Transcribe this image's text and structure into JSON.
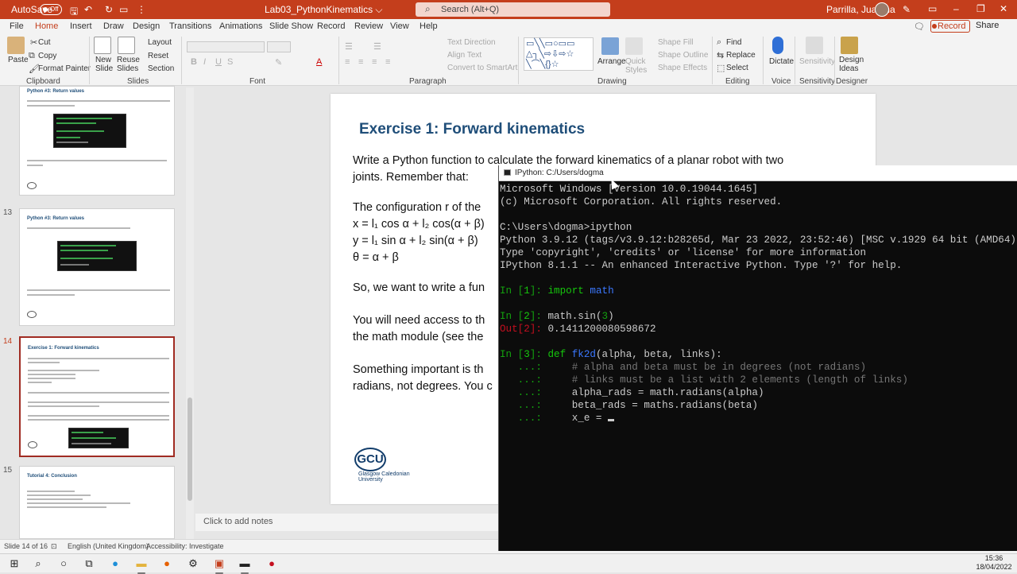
{
  "titlebar": {
    "autosave_label": "AutoSave",
    "autosave_state": "Off",
    "doc_title": "Lab03_PythonKinematics ⌵",
    "search_placeholder": "Search (Alt+Q)",
    "user_name": "Parrilla, Juanma",
    "minimize": "–",
    "restore": "❐",
    "close": "✕"
  },
  "tabs": [
    "File",
    "Home",
    "Insert",
    "Draw",
    "Design",
    "Transitions",
    "Animations",
    "Slide Show",
    "Record",
    "Review",
    "View",
    "Help"
  ],
  "active_tab": "Home",
  "record_button": "Record",
  "share_button": "Share",
  "ribbon": {
    "clipboard": {
      "paste": "Paste",
      "cut": "Cut",
      "copy": "Copy",
      "format_painter": "Format Painter",
      "group": "Clipboard"
    },
    "slides": {
      "new_slide": "New Slide",
      "reuse_slides": "Reuse Slides",
      "layout": "Layout",
      "reset": "Reset",
      "section": "Section",
      "group": "Slides"
    },
    "font": {
      "group": "Font"
    },
    "paragraph": {
      "text_direction": "Text Direction",
      "align_text": "Align Text",
      "smartart": "Convert to SmartArt",
      "group": "Paragraph"
    },
    "drawing": {
      "arrange": "Arrange",
      "quick_styles": "Quick Styles",
      "shape_fill": "Shape Fill",
      "shape_outline": "Shape Outline",
      "shape_effects": "Shape Effects",
      "group": "Drawing"
    },
    "editing": {
      "find": "Find",
      "replace": "Replace",
      "select": "Select",
      "group": "Editing"
    },
    "voice": {
      "dictate": "Dictate",
      "group": "Voice"
    },
    "sensitivity": {
      "label": "Sensitivity",
      "group": "Sensitivity"
    },
    "designer": {
      "design_ideas": "Design Ideas",
      "group": "Designer"
    }
  },
  "thumbnails": [
    {
      "title": "Python #3: Return values",
      "num": ""
    },
    {
      "title": "Python #3: Return values",
      "num": "13"
    },
    {
      "title": "Exercise 1: Forward kinematics",
      "num": "14"
    },
    {
      "title": "Tutorial 4: Conclusion",
      "num": "15"
    }
  ],
  "slide": {
    "title": "Exercise 1: Forward kinematics",
    "lines": [
      "Write a Python function to calculate the forward kinematics of a planar robot with two",
      "joints. Remember that:",
      "The configuration r of the",
      "x = l₁ cos α + l₂ cos(α + β)",
      "y = l₁ sin α + l₂ sin(α + β)",
      "θ = α + β",
      "So, we want to write a fun",
      "You will need access to th",
      "the math module (see the",
      "Something important is th",
      "radians, not degrees. You c"
    ],
    "logo_mark": "GCU",
    "logo_name_1": "Glasgow Caledonian",
    "logo_name_2": "University"
  },
  "notes_placeholder": "Click to add notes",
  "status": {
    "slide_count": "Slide 14 of 16",
    "language": "English (United Kingdom)",
    "accessibility": "Accessibility: Investigate"
  },
  "console": {
    "title": "IPython: C:/Users/dogma",
    "lines": [
      [
        {
          "t": "Microsoft Windows [Version 10.0.19044.1645]",
          "c": ""
        }
      ],
      [
        {
          "t": "(c) Microsoft Corporation. All rights reserved.",
          "c": ""
        }
      ],
      [
        {
          "t": "",
          "c": ""
        }
      ],
      [
        {
          "t": "C:\\Users\\dogma>ipython",
          "c": ""
        }
      ],
      [
        {
          "t": "Python 3.9.12 (tags/v3.9.12:b28265d, Mar 23 2022, 23:52:46) [MSC v.1929 64 bit (AMD64)]",
          "c": ""
        }
      ],
      [
        {
          "t": "Type 'copyright', 'credits' or 'license' for more information",
          "c": ""
        }
      ],
      [
        {
          "t": "IPython 8.1.1 -- An enhanced Interactive Python. Type '?' for help.",
          "c": ""
        }
      ],
      [
        {
          "t": "",
          "c": ""
        }
      ],
      [
        {
          "t": "In [",
          "c": "gb"
        },
        {
          "t": "1",
          "c": "g"
        },
        {
          "t": "]: ",
          "c": "gb"
        },
        {
          "t": "import ",
          "c": "g"
        },
        {
          "t": "math",
          "c": "b"
        }
      ],
      [
        {
          "t": "",
          "c": ""
        }
      ],
      [
        {
          "t": "In [",
          "c": "gb"
        },
        {
          "t": "2",
          "c": "g"
        },
        {
          "t": "]: ",
          "c": "gb"
        },
        {
          "t": "math.sin(",
          "c": ""
        },
        {
          "t": "3",
          "c": "gb"
        },
        {
          "t": ")",
          "c": ""
        }
      ],
      [
        {
          "t": "Out[",
          "c": "r"
        },
        {
          "t": "2",
          "c": "r"
        },
        {
          "t": "]: ",
          "c": "r"
        },
        {
          "t": "0.1411200080598672",
          "c": ""
        }
      ],
      [
        {
          "t": "",
          "c": ""
        }
      ],
      [
        {
          "t": "In [",
          "c": "gb"
        },
        {
          "t": "3",
          "c": "g"
        },
        {
          "t": "]: ",
          "c": "gb"
        },
        {
          "t": "def ",
          "c": "g"
        },
        {
          "t": "fk2d",
          "c": "b"
        },
        {
          "t": "(alpha, beta, links):",
          "c": ""
        }
      ],
      [
        {
          "t": "   ...:     ",
          "c": "gb"
        },
        {
          "t": "# alpha and beta must be in degrees (not radians)",
          "c": "gr"
        }
      ],
      [
        {
          "t": "   ...:     ",
          "c": "gb"
        },
        {
          "t": "# links must be a list with 2 elements (length of links)",
          "c": "gr"
        }
      ],
      [
        {
          "t": "   ...:     ",
          "c": "gb"
        },
        {
          "t": "alpha_rads = math.radians(alpha)",
          "c": ""
        }
      ],
      [
        {
          "t": "   ...:     ",
          "c": "gb"
        },
        {
          "t": "beta_rads = maths.radians(beta)",
          "c": ""
        }
      ],
      [
        {
          "t": "   ...:     ",
          "c": "gb"
        },
        {
          "t": "x_e = ",
          "c": ""
        }
      ]
    ]
  },
  "clock": {
    "time": "15:36",
    "date": "18/04/2022"
  }
}
